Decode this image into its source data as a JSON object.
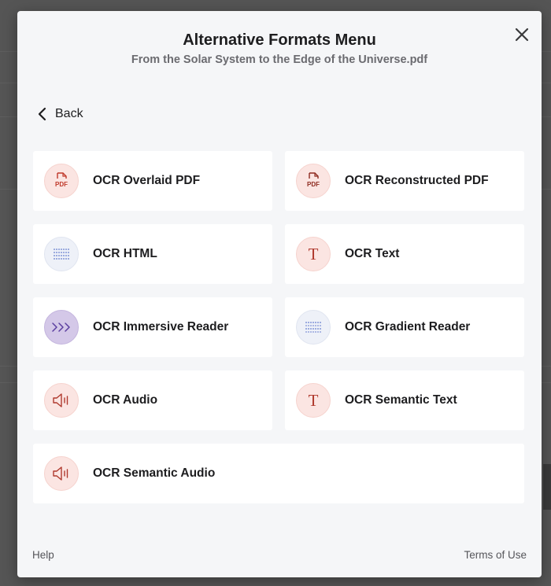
{
  "modal": {
    "title": "Alternative Formats Menu",
    "subtitle": "From the Solar System to the Edge of the Universe.pdf",
    "back_label": "Back",
    "close_icon": "close-icon"
  },
  "formats": [
    {
      "label": "OCR Overlaid PDF",
      "icon": "pdf-file-icon",
      "icon_text": "PDF"
    },
    {
      "label": "OCR Reconstructed PDF",
      "icon": "pdf-file-icon",
      "icon_text": "PDF"
    },
    {
      "label": "OCR HTML",
      "icon": "html-lines-icon"
    },
    {
      "label": "OCR Text",
      "icon": "text-t-icon",
      "icon_text": "T"
    },
    {
      "label": "OCR Immersive Reader",
      "icon": "immersive-reader-icon"
    },
    {
      "label": "OCR Gradient Reader",
      "icon": "gradient-lines-icon"
    },
    {
      "label": "OCR Audio",
      "icon": "speaker-icon"
    },
    {
      "label": "OCR Semantic Text",
      "icon": "text-t-icon",
      "icon_text": "T"
    },
    {
      "label": "OCR Semantic Audio",
      "icon": "speaker-icon"
    }
  ],
  "footer": {
    "help_label": "Help",
    "terms_label": "Terms of Use"
  },
  "colors": {
    "accent_red": "#c0392b",
    "accent_blue": "#5b74c9",
    "accent_purple": "#5b3fa0",
    "modal_bg": "#f5f6f8"
  }
}
